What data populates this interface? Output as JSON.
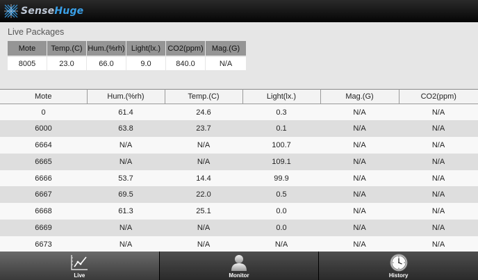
{
  "app": {
    "logo_part1": "Sense",
    "logo_part2": "Huge"
  },
  "live": {
    "title": "Live Packages",
    "columns": [
      "Mote",
      "Temp.(C)",
      "Hum.(%rh)",
      "Light(lx.)",
      "CO2(ppm)",
      "Mag.(G)"
    ],
    "row": [
      "8005",
      "23.0",
      "66.0",
      "9.0",
      "840.0",
      "N/A"
    ]
  },
  "history": {
    "columns": [
      "Mote",
      "Hum.(%rh)",
      "Temp.(C)",
      "Light(lx.)",
      "Mag.(G)",
      "CO2(ppm)"
    ],
    "rows": [
      [
        "0",
        "61.4",
        "24.6",
        "0.3",
        "N/A",
        "N/A"
      ],
      [
        "6000",
        "63.8",
        "23.7",
        "0.1",
        "N/A",
        "N/A"
      ],
      [
        "6664",
        "N/A",
        "N/A",
        "100.7",
        "N/A",
        "N/A"
      ],
      [
        "6665",
        "N/A",
        "N/A",
        "109.1",
        "N/A",
        "N/A"
      ],
      [
        "6666",
        "53.7",
        "14.4",
        "99.9",
        "N/A",
        "N/A"
      ],
      [
        "6667",
        "69.5",
        "22.0",
        "0.5",
        "N/A",
        "N/A"
      ],
      [
        "6668",
        "61.3",
        "25.1",
        "0.0",
        "N/A",
        "N/A"
      ],
      [
        "6669",
        "N/A",
        "N/A",
        "0.0",
        "N/A",
        "N/A"
      ],
      [
        "6673",
        "N/A",
        "N/A",
        "N/A",
        "N/A",
        "N/A"
      ]
    ]
  },
  "tabs": [
    {
      "label": "Live",
      "icon": "chart-icon",
      "active": true
    },
    {
      "label": "Monitor",
      "icon": "person-icon",
      "active": false
    },
    {
      "label": "History",
      "icon": "clock-icon",
      "active": false
    }
  ],
  "colors": {
    "titlebar": "#050505",
    "logo_accent": "#3aa0e8",
    "live_header": "#959595",
    "row_even": "#dedede",
    "row_odd": "#f8f8f8"
  }
}
